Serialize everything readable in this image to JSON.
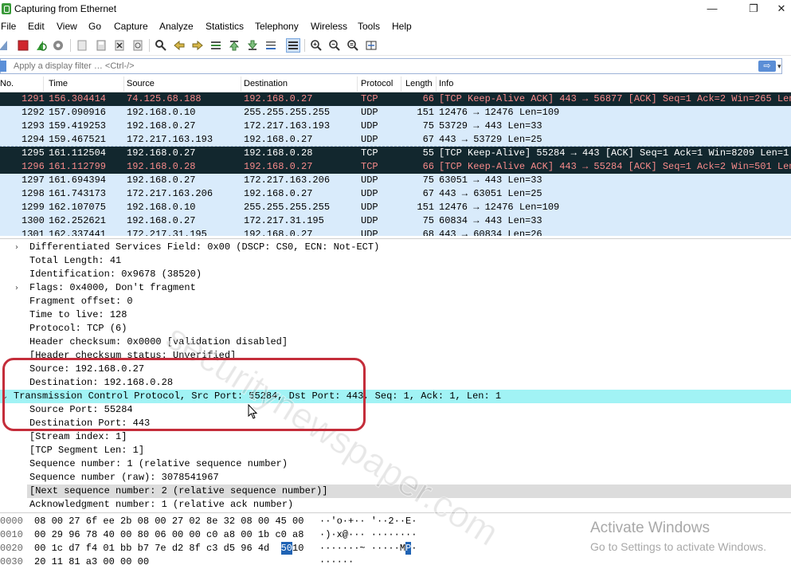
{
  "window": {
    "title": "Capturing from Ethernet",
    "minimize": "—",
    "restore": "❐",
    "close": "✕"
  },
  "menu": [
    "File",
    "Edit",
    "View",
    "Go",
    "Capture",
    "Analyze",
    "Statistics",
    "Telephony",
    "Wireless",
    "Tools",
    "Help"
  ],
  "toolbar_icons": [
    "shark-fin-icon",
    "stop-capture-icon",
    "restart-capture-icon",
    "capture-options-icon",
    "open-file-icon",
    "save-file-icon",
    "close-file-icon",
    "reload-file-icon",
    "find-packet-icon",
    "go-back-icon",
    "go-forward-icon",
    "go-to-packet-icon",
    "go-first-icon",
    "go-last-icon",
    "autoscroll-icon",
    "colorize-icon",
    "zoom-in-icon",
    "zoom-out-icon",
    "zoom-normal-icon",
    "resize-columns-icon"
  ],
  "filter": {
    "placeholder": "Apply a display filter … <Ctrl-/>",
    "apply": "⇨"
  },
  "packet_columns": [
    "No.",
    "Time",
    "Source",
    "Destination",
    "Protocol",
    "Length",
    "Info"
  ],
  "packets": [
    {
      "no": "1291",
      "time": "156.304414",
      "src": "74.125.68.188",
      "dst": "192.168.0.27",
      "proto": "TCP",
      "len": "66",
      "info": "[TCP Keep-Alive ACK] 443 → 56877 [ACK] Seq=1 Ack=2 Win=265 Len…",
      "style": "dark"
    },
    {
      "no": "1292",
      "time": "157.090916",
      "src": "192.168.0.10",
      "dst": "255.255.255.255",
      "proto": "UDP",
      "len": "151",
      "info": "12476 → 12476 Len=109",
      "style": "udp"
    },
    {
      "no": "1293",
      "time": "159.419253",
      "src": "192.168.0.27",
      "dst": "172.217.163.193",
      "proto": "UDP",
      "len": "75",
      "info": "53729 → 443 Len=33",
      "style": "udp"
    },
    {
      "no": "1294",
      "time": "159.467521",
      "src": "172.217.163.193",
      "dst": "192.168.0.27",
      "proto": "UDP",
      "len": "67",
      "info": "443 → 53729 Len=25",
      "style": "udp"
    },
    {
      "no": "1295",
      "time": "161.112504",
      "src": "192.168.0.27",
      "dst": "192.168.0.28",
      "proto": "TCP",
      "len": "55",
      "info": "[TCP Keep-Alive] 55284 → 443 [ACK] Seq=1 Ack=1 Win=8209 Len=1",
      "style": "selected"
    },
    {
      "no": "1296",
      "time": "161.112799",
      "src": "192.168.0.28",
      "dst": "192.168.0.27",
      "proto": "TCP",
      "len": "66",
      "info": "[TCP Keep-Alive ACK] 443 → 55284 [ACK] Seq=1 Ack=2 Win=501 Len…",
      "style": "dark"
    },
    {
      "no": "1297",
      "time": "161.694394",
      "src": "192.168.0.27",
      "dst": "172.217.163.206",
      "proto": "UDP",
      "len": "75",
      "info": "63051 → 443 Len=33",
      "style": "udp"
    },
    {
      "no": "1298",
      "time": "161.743173",
      "src": "172.217.163.206",
      "dst": "192.168.0.27",
      "proto": "UDP",
      "len": "67",
      "info": "443 → 63051 Len=25",
      "style": "udp"
    },
    {
      "no": "1299",
      "time": "162.107075",
      "src": "192.168.0.10",
      "dst": "255.255.255.255",
      "proto": "UDP",
      "len": "151",
      "info": "12476 → 12476 Len=109",
      "style": "udp"
    },
    {
      "no": "1300",
      "time": "162.252621",
      "src": "192.168.0.27",
      "dst": "172.217.31.195",
      "proto": "UDP",
      "len": "75",
      "info": "60834 → 443 Len=33",
      "style": "udp"
    },
    {
      "no": "1301",
      "time": "162.337441",
      "src": "172.217.31.195",
      "dst": "192.168.0.27",
      "proto": "UDP",
      "len": "68",
      "info": "443 → 60834 Len=26",
      "style": "udp"
    }
  ],
  "details": [
    {
      "text": "Differentiated Services Field: 0x00 (DSCP: CS0, ECN: Not-ECT)",
      "indent": 1,
      "expander": "collapsed"
    },
    {
      "text": "Total Length: 41",
      "indent": 1
    },
    {
      "text": "Identification: 0x9678 (38520)",
      "indent": 1
    },
    {
      "text": "Flags: 0x4000, Don't fragment",
      "indent": 1,
      "expander": "collapsed"
    },
    {
      "text": "Fragment offset: 0",
      "indent": 1
    },
    {
      "text": "Time to live: 128",
      "indent": 1
    },
    {
      "text": "Protocol: TCP (6)",
      "indent": 1
    },
    {
      "text": "Header checksum: 0x0000 [validation disabled]",
      "indent": 1
    },
    {
      "text": "[Header checksum status: Unverified]",
      "indent": 1
    },
    {
      "text": "Source: 192.168.0.27",
      "indent": 1
    },
    {
      "text": "Destination: 192.168.0.28",
      "indent": 1
    },
    {
      "text": "Transmission Control Protocol, Src Port: 55284, Dst Port: 443, Seq: 1, Ack: 1, Len: 1",
      "indent": 0,
      "expander": "expanded",
      "highlight": "cyan"
    },
    {
      "text": "Source Port: 55284",
      "indent": 1
    },
    {
      "text": "Destination Port: 443",
      "indent": 1
    },
    {
      "text": "[Stream index: 1]",
      "indent": 1
    },
    {
      "text": "[TCP Segment Len: 1]",
      "indent": 1
    },
    {
      "text": "Sequence number: 1    (relative sequence number)",
      "indent": 1
    },
    {
      "text": "Sequence number (raw): 3078541967",
      "indent": 1
    },
    {
      "text": "[Next sequence number: 2    (relative sequence number)]",
      "indent": 1,
      "highlight": "grey"
    },
    {
      "text": "Acknowledgment number: 1    (relative ack number)",
      "indent": 1
    }
  ],
  "hex": [
    {
      "offset": "0000",
      "hex": "08 00 27 6f ee 2b 08 00  27 02 8e 32 08 00 45 00",
      "ascii": "··'o·+·· '··2··E·"
    },
    {
      "offset": "0010",
      "hex": "00 29 96 78 40 00 80 06  00 00 c0 a8 00 1b c0 a8",
      "ascii": "·)·x@··· ········"
    },
    {
      "offset": "0020",
      "hex_pre": "00 1c d7 f4 01 bb b7 7e  d2 8f c3 d5 96 4d ",
      "hex_sel": "50",
      "hex_post": " 10",
      "ascii_pre": "·······~ ·····M",
      "ascii_sel": "P",
      "ascii_post": "·"
    },
    {
      "offset": "0030",
      "hex": "20 11 81 a3 00 00 00",
      "ascii": " ······"
    }
  ],
  "watermark": "securitynewspaper.com",
  "activation": {
    "title": "Activate Windows",
    "subtitle": "Go to Settings to activate Windows."
  },
  "colors": {
    "dark_row_bg": "#12272e",
    "dark_row_fg": "#f78a8a",
    "selected_row_bg": "#12272e",
    "selected_row_fg": "#ffffff",
    "udp_row_bg": "#d9ebfb",
    "tcp_highlight": "#a1f3f5",
    "annotation": "#c42d3a"
  }
}
